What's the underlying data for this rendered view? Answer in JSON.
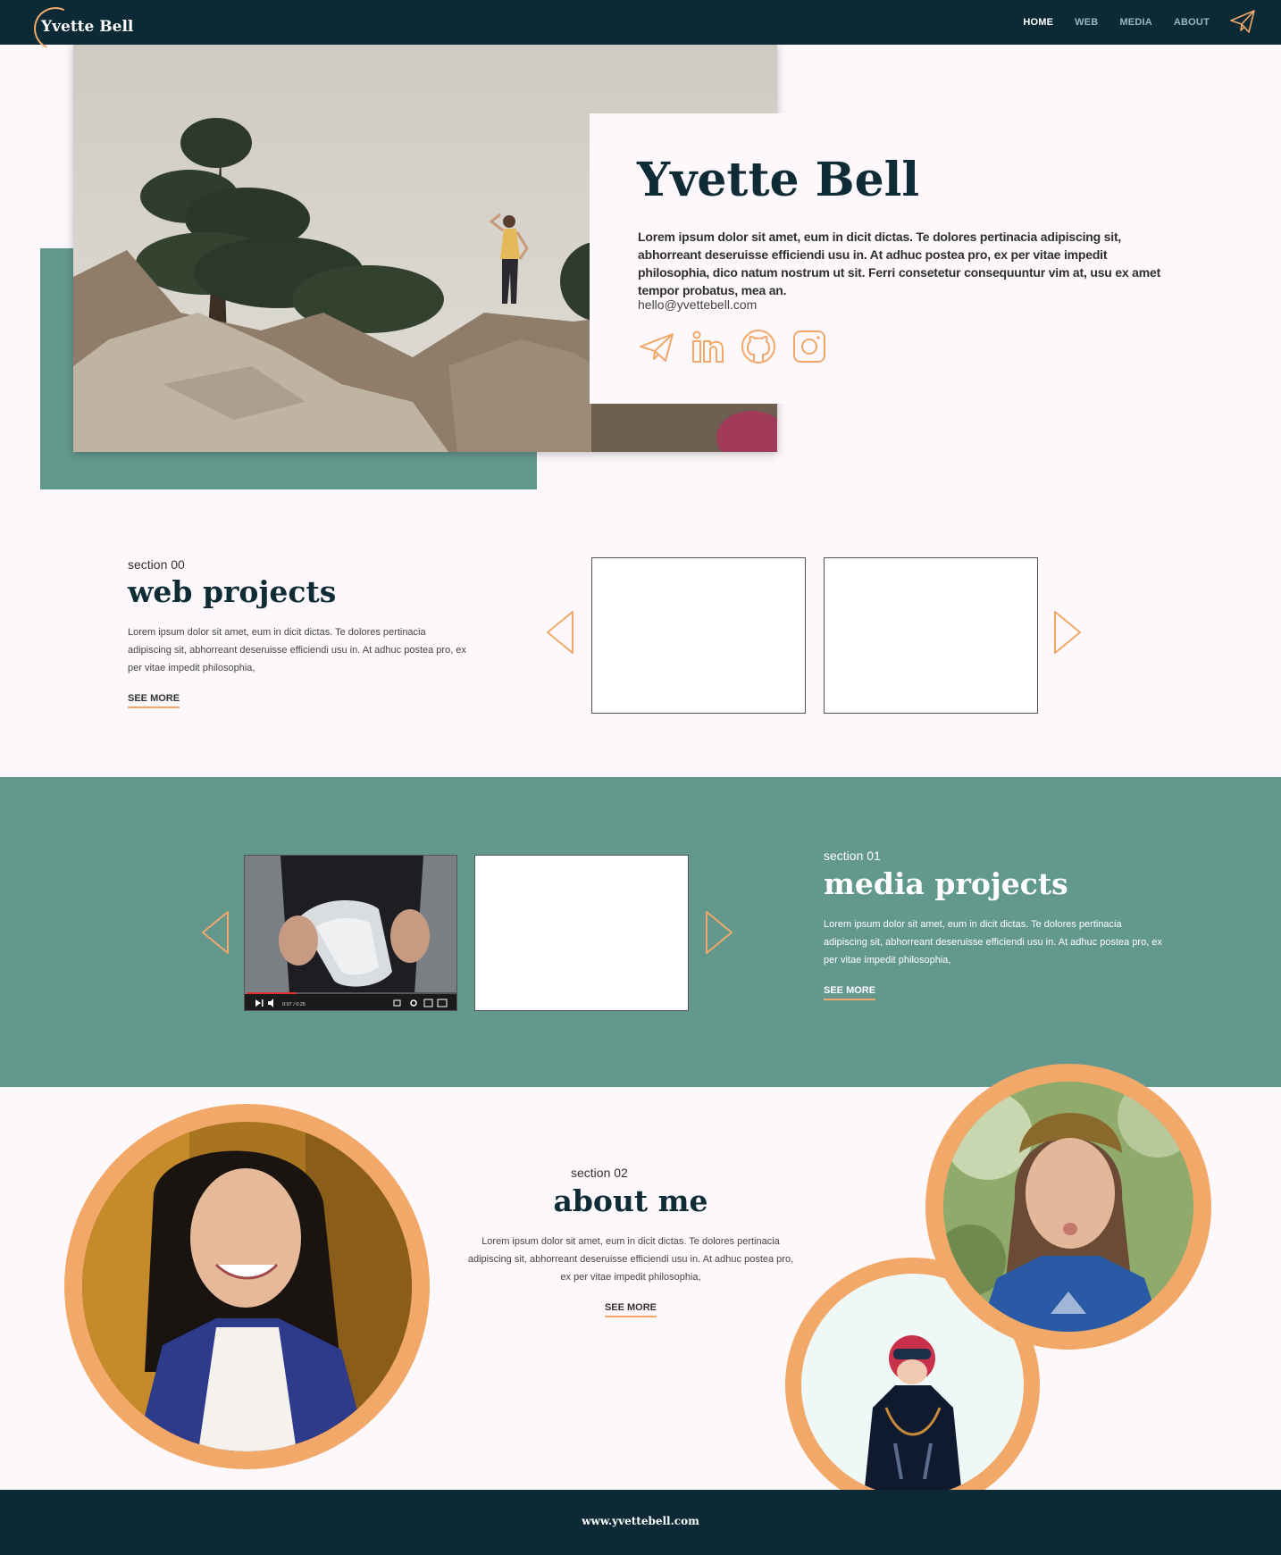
{
  "nav": {
    "logo": "Yvette Bell",
    "links": [
      "HOME",
      "WEB",
      "MEDIA",
      "ABOUT"
    ],
    "active": "HOME",
    "action_icon": "paper-plane-icon"
  },
  "hero": {
    "name": "Yvette Bell",
    "description": "Lorem ipsum dolor sit amet, eum in dicit dictas. Te dolores pertinacia adipiscing sit, abhorreant deseruisse efficiendi usu in. At adhuc postea pro, ex per vitae impedit philosophia, dico natum nostrum ut sit. Ferri consetetur consequuntur vim at, usu ex amet tempor probatus, mea an.",
    "email": "hello@yvettebell.com",
    "social_icons": [
      "paper-plane-icon",
      "linkedin-icon",
      "github-icon",
      "instagram-icon"
    ]
  },
  "web": {
    "label": "section 00",
    "title": "web projects",
    "description": "Lorem ipsum dolor sit amet, eum in dicit dictas. Te dolores pertinacia adipiscing sit, abhorreant deseruisse efficiendi usu in. At adhuc postea pro, ex per vitae impedit philosophia,",
    "see_more": "SEE MORE"
  },
  "media": {
    "label": "section 01",
    "title": "media projects",
    "description": "Lorem ipsum dolor sit amet, eum in dicit dictas. Te dolores pertinacia adipiscing sit, abhorreant deseruisse efficiendi usu in. At adhuc postea pro, ex per vitae impedit philosophia,",
    "see_more": "SEE MORE",
    "video_time": "0:07 / 0:25",
    "video_progress": 0.24
  },
  "about": {
    "label": "section 02",
    "title": "about me",
    "description": "Lorem ipsum dolor sit amet, eum in dicit dictas. Te dolores pertinacia adipiscing sit, abhorreant deseruisse efficiendi usu in. At adhuc postea pro, ex per vitae impedit philosophia,",
    "see_more": "SEE MORE"
  },
  "footer": {
    "text": "www.yvettebell.com"
  },
  "colors": {
    "navy": "#0b2a36",
    "teal": "#63988d",
    "accent": "#f2a868",
    "background": "#fdf8fb"
  }
}
